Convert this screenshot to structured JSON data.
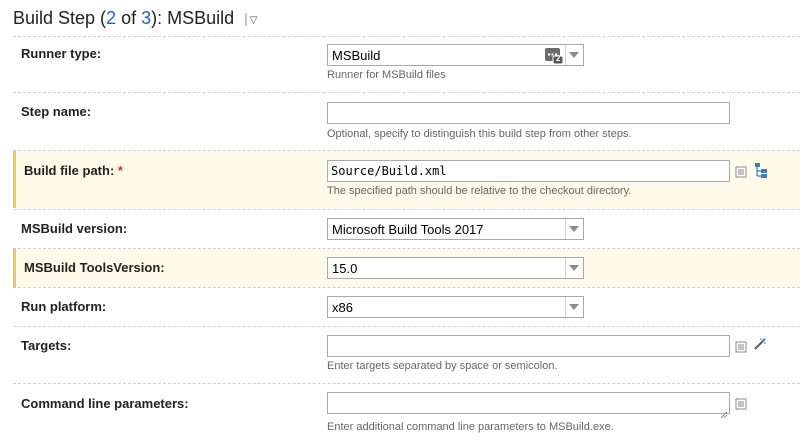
{
  "header": {
    "prefix": "Build Step (",
    "step_current": "2",
    "of_text": " of ",
    "step_total": "3",
    "suffix": "): MSBuild",
    "separator": "|",
    "menu_glyph": "▽"
  },
  "fields": {
    "runner_type": {
      "label": "Runner type:",
      "value": "MSBuild",
      "hint": "Runner for MSBuild files"
    },
    "step_name": {
      "label": "Step name:",
      "value": "",
      "hint": "Optional, specify to distinguish this build step from other steps."
    },
    "build_file_path": {
      "label": "Build file path:",
      "required_mark": "*",
      "value": "Source/Build.xml",
      "hint": "The specified path should be relative to the checkout directory."
    },
    "msbuild_version": {
      "label": "MSBuild version:",
      "value": "Microsoft Build Tools 2017"
    },
    "tools_version": {
      "label": "MSBuild ToolsVersion:",
      "value": "15.0"
    },
    "run_platform": {
      "label": "Run platform:",
      "value": "x86"
    },
    "targets": {
      "label": "Targets:",
      "value": "",
      "hint": "Enter targets separated by space or semicolon."
    },
    "command_line": {
      "label": "Command line parameters:",
      "value": "",
      "hint": "Enter additional command line parameters to MSBuild.exe."
    }
  },
  "icons": {
    "runner_badge": "runner-selector-icon",
    "runner_badge_count": "2",
    "text_editor": "text-editor-icon",
    "tree_browser": "file-tree-icon",
    "magic_wand": "magic-wand-icon"
  },
  "colors": {
    "link": "#1d62c4",
    "highlight_bg": "#fffbe8",
    "highlight_border": "#e8c86a",
    "required": "#dd3333"
  }
}
